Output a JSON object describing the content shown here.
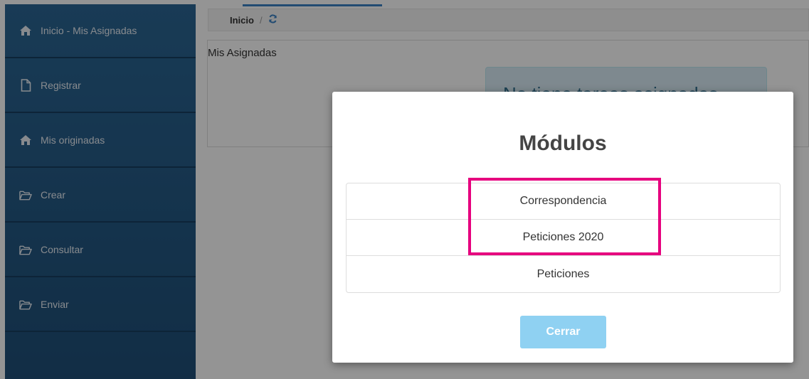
{
  "sidebar": {
    "items": [
      {
        "label": "Inicio - Mis Asignadas",
        "icon": "home-icon"
      },
      {
        "label": "Registrar",
        "icon": "file-icon"
      },
      {
        "label": "Mis originadas",
        "icon": "home-icon"
      },
      {
        "label": "Crear",
        "icon": "folder-open-icon"
      },
      {
        "label": "Consultar",
        "icon": "folder-open-icon"
      },
      {
        "label": "Enviar",
        "icon": "folder-open-icon"
      }
    ]
  },
  "breadcrumb": {
    "home": "Inicio",
    "separator": "/",
    "refresh_icon": "refresh-icon"
  },
  "panel": {
    "title": "Mis Asignadas",
    "alert": "No tiene tareas asignadas"
  },
  "modal": {
    "title": "Módulos",
    "items": [
      {
        "label": "Correspondencia"
      },
      {
        "label": "Peticiones 2020"
      },
      {
        "label": "Peticiones"
      }
    ],
    "close_label": "Cerrar"
  },
  "colors": {
    "sidebar": "#235a85",
    "highlight": "#e6007e",
    "close_button": "#8fd1f2",
    "accent": "#3b82c4"
  }
}
